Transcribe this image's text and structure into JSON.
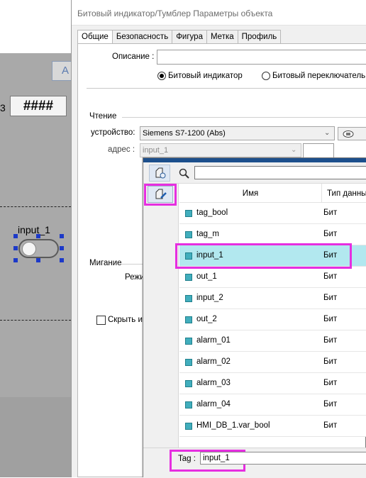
{
  "background": {
    "button_label": "A",
    "display_text": "####",
    "left_digit": "3",
    "toggle_label": "input_1"
  },
  "dialog": {
    "title": "Битовый индикатор/Тумблер Параметры объекта",
    "tabs": [
      "Общие",
      "Безопасность",
      "Фигура",
      "Метка",
      "Профиль"
    ],
    "description_label": "Описание :",
    "description_value": "",
    "mode_indicator": "Битовый индикатор",
    "mode_switch": "Битовый переключатель",
    "read_group": "Чтение",
    "device_label": "устройство:",
    "device_value": "Siemens S7-1200 (Abs)",
    "address_label": "адрес :",
    "address_value": "input_1",
    "blink_group": "Мигание",
    "mode_label_partial": "Режи",
    "hide_checkbox_label": "Скрыть из"
  },
  "tag_picker": {
    "search_placeholder": "",
    "column_name": "Имя",
    "column_type": "Тип данны",
    "rows": [
      {
        "name": "tag_bool",
        "type": "Бит"
      },
      {
        "name": "tag_m",
        "type": "Бит"
      },
      {
        "name": "input_1",
        "type": "Бит"
      },
      {
        "name": "out_1",
        "type": "Бит"
      },
      {
        "name": "input_2",
        "type": "Бит"
      },
      {
        "name": "out_2",
        "type": "Бит"
      },
      {
        "name": "alarm_01",
        "type": "Бит"
      },
      {
        "name": "alarm_02",
        "type": "Бит"
      },
      {
        "name": "alarm_03",
        "type": "Бит"
      },
      {
        "name": "alarm_04",
        "type": "Бит"
      },
      {
        "name": "HMI_DB_1.var_bool",
        "type": "Бит"
      }
    ],
    "selected_row": "input_1",
    "tag_label": "Tag :",
    "tag_value": "input_1"
  },
  "colors": {
    "highlight": "#e62ee0",
    "selected_row": "#b2e8ef",
    "popup_header": "#1c4f8c",
    "tag_icon": "#41aebd"
  }
}
